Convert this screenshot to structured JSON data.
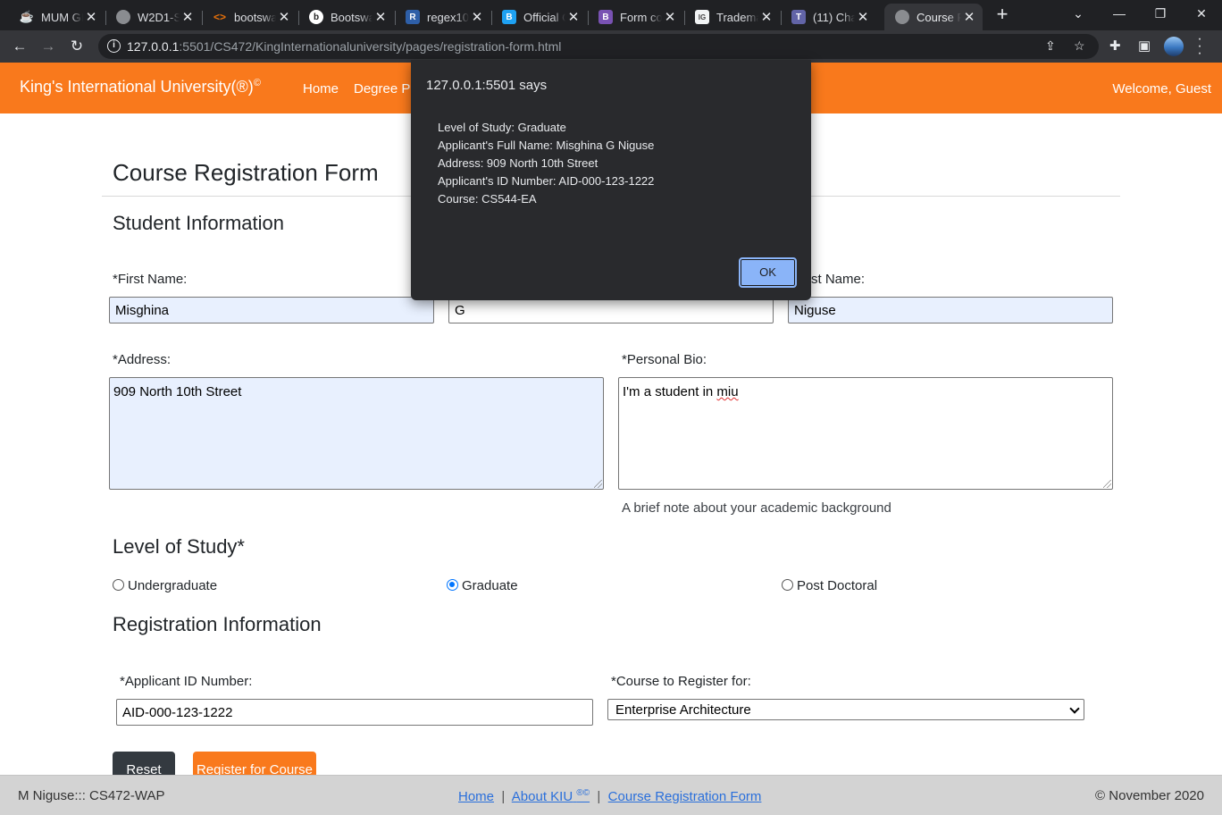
{
  "browser": {
    "tabs": [
      {
        "label": "MUM GI",
        "icon": "java-icon",
        "color": "#5b8fd8"
      },
      {
        "label": "W2D1-S",
        "icon": "globe-icon",
        "color": "#8a8c90"
      },
      {
        "label": "bootswa",
        "icon": "code-icon",
        "color": "#e8710a"
      },
      {
        "label": "Bootswa",
        "icon": "bootswatch-icon",
        "color": "#3a3a3a"
      },
      {
        "label": "regex10",
        "icon": "regex-icon",
        "color": "#2e5fa8"
      },
      {
        "label": "Official C",
        "icon": "bootstrap-blue-icon",
        "color": "#1ea1f2"
      },
      {
        "label": "Form co",
        "icon": "bootstrap-purple-icon",
        "color": "#7952b3"
      },
      {
        "label": "Tradema",
        "icon": "trademark-icon",
        "color": "#f1f3f4"
      },
      {
        "label": "(11) Cha",
        "icon": "teams-icon",
        "color": "#6264a7"
      },
      {
        "label": "Course F",
        "icon": "globe-icon",
        "color": "#8a8c90",
        "active": true
      }
    ],
    "url_host": "127.0.0.1",
    "url_rest": ":5501/CS472/KingInternationaluniversity/pages/registration-form.html"
  },
  "site": {
    "brand": "King's International University(®)",
    "brand_sup": "©",
    "nav": [
      "Home",
      "Degree Pr"
    ],
    "welcome": "Welcome, Guest"
  },
  "form": {
    "title": "Course Registration Form",
    "student_section": "Student Information",
    "first_name_label": "*First Name:",
    "first_name_value": "Misghina",
    "middle_name_value": "G",
    "last_name_label": "st Name:",
    "last_name_value": "Niguse",
    "address_label": "*Address:",
    "address_value": "909 North 10th Street",
    "bio_label": "*Personal Bio:",
    "bio_value_prefix": "I'm a student in ",
    "bio_value_misspelled": "miu",
    "bio_help": "A brief note about your academic background",
    "level_section": "Level of Study*",
    "levels": [
      "Undergraduate",
      "Graduate",
      "Post Doctoral"
    ],
    "selected_level": "Graduate",
    "registration_section": "Registration Information",
    "applicant_id_label": "*Applicant ID Number:",
    "applicant_id_value": "AID-000-123-1222",
    "course_label": "*Course to Register for:",
    "course_value": "Enterprise Architecture",
    "reset_label": "Reset",
    "register_label": "Register for Course"
  },
  "footer": {
    "left": "M Niguse::: CS472-WAP",
    "links": [
      "Home",
      "About KIU",
      "Course Registration Form"
    ],
    "about_sup": "®©",
    "separator": "|",
    "right": "© November 2020"
  },
  "dialog": {
    "title": "127.0.0.1:5501 says",
    "lines": [
      "Level of Study: Graduate",
      "Applicant's Full Name: Misghina G Niguse",
      "Address: 909 North 10th Street",
      "Applicant's ID Number: AID-000-123-1222",
      "Course: CS544-EA"
    ],
    "ok_label": "OK"
  }
}
